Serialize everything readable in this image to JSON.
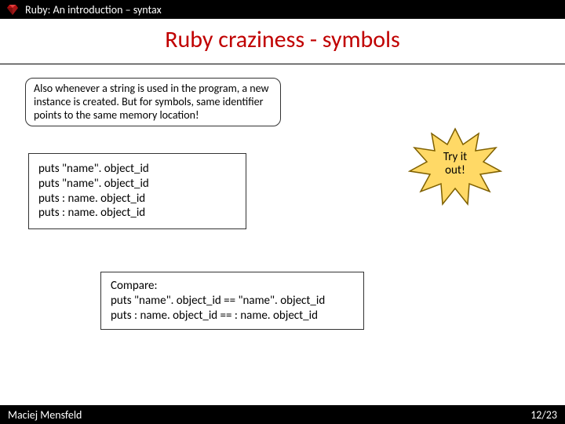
{
  "header": {
    "breadcrumb": "Ruby: An introduction – syntax"
  },
  "title": "Ruby craziness - symbols",
  "note": "Also whenever a string is used in the program, a new instance is created. But for symbols, same identifier points to the same memory location!",
  "code1": {
    "line1": "puts \"name\". object_id",
    "line2": "puts \"name\". object_id",
    "line3": "puts : name. object_id",
    "line4": "puts : name. object_id"
  },
  "starburst": {
    "line1": "Try it",
    "line2": "out!"
  },
  "code2": {
    "line1": "Compare:",
    "line2": "puts \"name\". object_id == \"name\". object_id",
    "line3": "puts : name. object_id == : name. object_id"
  },
  "footer": {
    "author": "Maciej Mensfeld",
    "page": "12/23"
  }
}
